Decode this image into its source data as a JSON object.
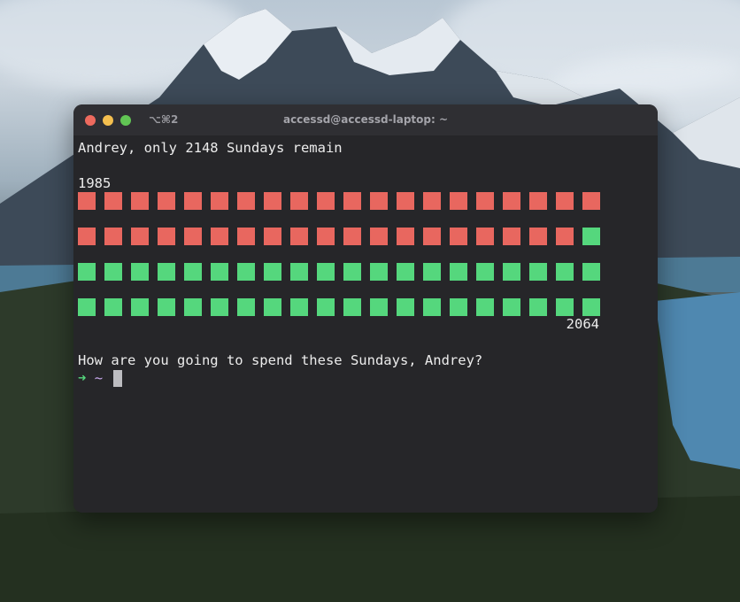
{
  "window": {
    "shortcut": "⌥⌘2",
    "title": "accessd@accessd-laptop: ~"
  },
  "terminal": {
    "heading": "Andrey, only 2148 Sundays remain",
    "start_year": "1985",
    "end_year": "2064",
    "question": "How are you going to spend these Sundays, Andrey?",
    "prompt_arrow": "➜",
    "prompt_dir": "~"
  },
  "grid": {
    "rows": 4,
    "columns": 20,
    "past_cells": 39,
    "total_cells": 80,
    "past_color": "#e8675f",
    "future_color": "#55d77d"
  },
  "colors": {
    "terminal_bg": "#262629",
    "titlebar_bg": "#2f2f33",
    "text": "#ececec"
  }
}
